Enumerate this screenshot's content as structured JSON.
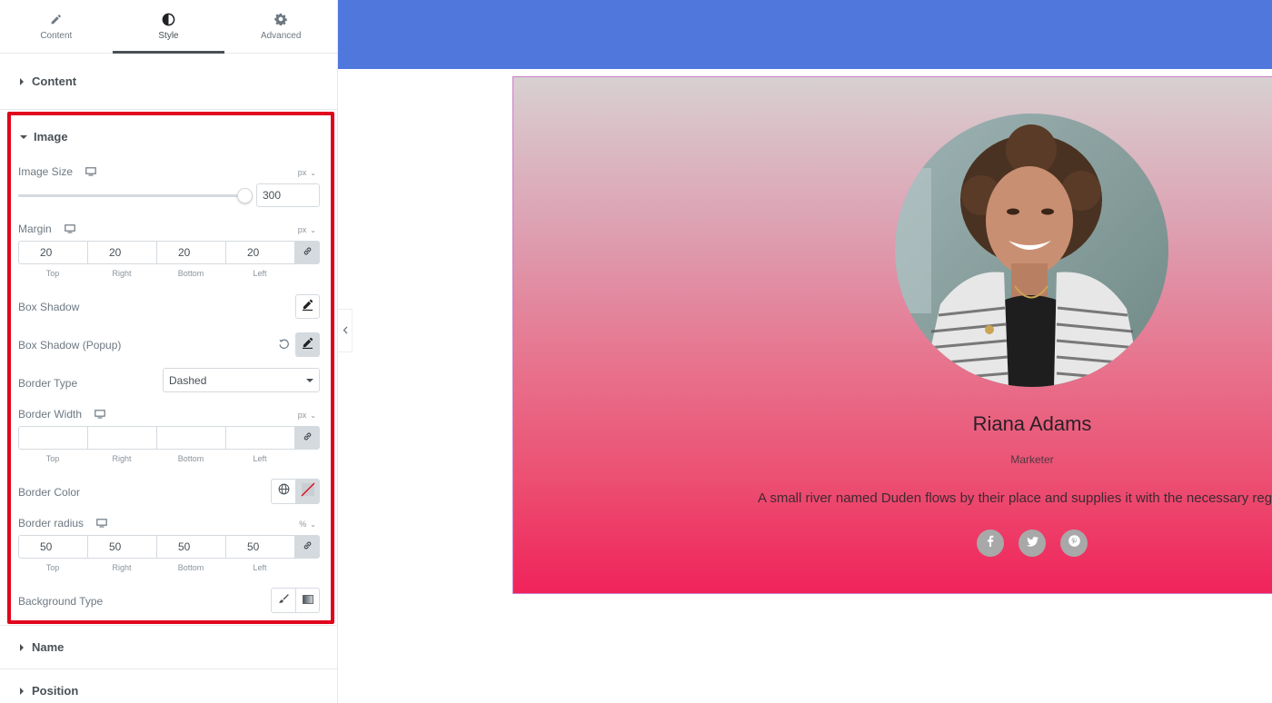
{
  "tabs": [
    {
      "label": "Content",
      "icon": "pencil-icon"
    },
    {
      "label": "Style",
      "icon": "contrast-icon",
      "active": true
    },
    {
      "label": "Advanced",
      "icon": "gear-icon"
    }
  ],
  "sections": {
    "content": "Content",
    "image": "Image",
    "name": "Name",
    "position": "Position"
  },
  "image_controls": {
    "image_size": {
      "label": "Image Size",
      "unit": "px",
      "value": "300"
    },
    "margin": {
      "label": "Margin",
      "unit": "px",
      "values": [
        "20",
        "20",
        "20",
        "20"
      ],
      "sides": [
        "Top",
        "Right",
        "Bottom",
        "Left"
      ]
    },
    "box_shadow": {
      "label": "Box Shadow"
    },
    "box_shadow_popup": {
      "label": "Box Shadow (Popup)"
    },
    "border_type": {
      "label": "Border Type",
      "value": "Dashed"
    },
    "border_width": {
      "label": "Border Width",
      "unit": "px",
      "values": [
        "",
        "",
        "",
        ""
      ],
      "sides": [
        "Top",
        "Right",
        "Bottom",
        "Left"
      ]
    },
    "border_color": {
      "label": "Border Color"
    },
    "border_radius": {
      "label": "Border radius",
      "unit": "%",
      "values": [
        "50",
        "50",
        "50",
        "50"
      ],
      "sides": [
        "Top",
        "Right",
        "Bottom",
        "Left"
      ]
    },
    "background_type": {
      "label": "Background Type"
    }
  },
  "preview": {
    "name": "Riana Adams",
    "role": "Marketer",
    "description": "A small river named Duden flows by their place and supplies it with the necessary regelialia.",
    "social": [
      "facebook-icon",
      "twitter-icon",
      "pinterest-icon"
    ]
  },
  "colors": {
    "topbar": "#5078dc",
    "highlight_border": "#e0051d",
    "gradient_top": "#d8d0d1",
    "gradient_bottom": "#f0235a"
  }
}
